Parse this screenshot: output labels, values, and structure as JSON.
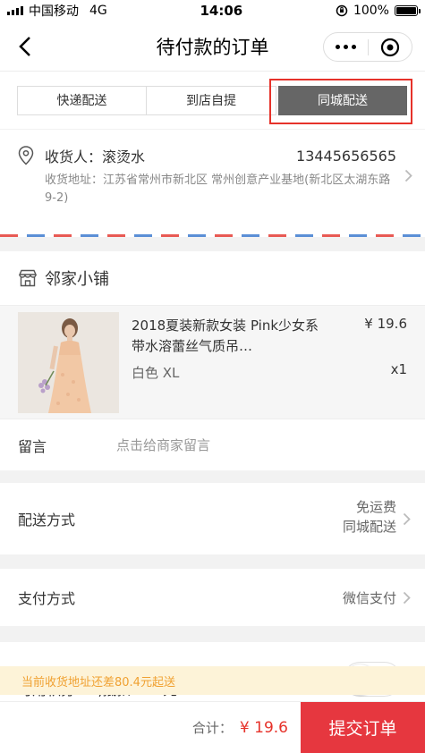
{
  "status_bar": {
    "carrier": "中国移动",
    "network": "4G",
    "time": "14:06",
    "battery": "100%",
    "battery_level": 1.0
  },
  "nav": {
    "title": "待付款的订单"
  },
  "delivery_tabs": [
    {
      "label": "快递配送",
      "active": false
    },
    {
      "label": "到店自提",
      "active": false
    },
    {
      "label": "同城配送",
      "active": true
    }
  ],
  "address": {
    "name_label": "收货人：滚烫水",
    "phone": "13445656565",
    "detail": "收货地址：江苏省常州市新北区 常州创意产业基地(新北区太湖东路9-2)"
  },
  "shop": {
    "name": "邻家小铺"
  },
  "product": {
    "title": "2018夏装新款女装 Pink少女系带水溶蕾丝气质吊…",
    "spec": "白色 XL",
    "price": "¥ 19.6",
    "quantity": "x1"
  },
  "message": {
    "label": "留言",
    "placeholder": "点击给商家留言"
  },
  "shipping": {
    "label": "配送方式",
    "fee": "免运费",
    "method": "同城配送"
  },
  "payment": {
    "label": "支付方式",
    "method": "微信支付"
  },
  "points": {
    "label": "可用积分7.8,抵扣0.39元",
    "enabled": false
  },
  "notice": "当前收货地址还差80.4元起送",
  "footer": {
    "total_label": "合计：",
    "total_value": "¥ 19.6",
    "submit_label": "提交订单"
  },
  "colors": {
    "accent": "#e6373f",
    "highlight": "#e6322a",
    "notice_bg": "#fdf3d8",
    "notice_text": "#f0a132",
    "active_tab": "#666666"
  }
}
